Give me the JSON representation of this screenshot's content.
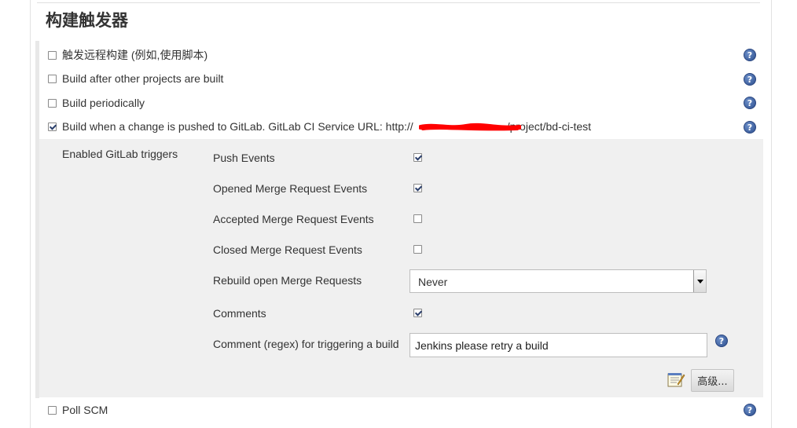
{
  "section": {
    "title": "构建触发器"
  },
  "triggers": [
    {
      "label": "触发远程构建 (例如,使用脚本)",
      "checked": false
    },
    {
      "label": "Build after other projects are built",
      "checked": false
    },
    {
      "label": "Build periodically",
      "checked": false
    },
    {
      "label": "Build when a change is pushed to GitLab. GitLab CI Service URL: http://",
      "url_tail": "/project/bd-ci-test",
      "checked": true
    },
    {
      "label": "Poll SCM",
      "checked": false
    }
  ],
  "gitlab": {
    "group_label": "Enabled GitLab triggers",
    "events": [
      {
        "label": "Push Events",
        "checked": true
      },
      {
        "label": "Opened Merge Request Events",
        "checked": true
      },
      {
        "label": "Accepted Merge Request Events",
        "checked": false
      },
      {
        "label": "Closed Merge Request Events",
        "checked": false
      }
    ],
    "rebuild": {
      "label": "Rebuild open Merge Requests",
      "value": "Never"
    },
    "comments": {
      "label": "Comments",
      "checked": true
    },
    "comment_regex": {
      "label": "Comment (regex) for triggering a build",
      "value": "Jenkins please retry a build"
    },
    "advanced_label": "高级..."
  },
  "icons": {
    "help": "help-icon",
    "notepad": "notepad-icon"
  },
  "colors": {
    "subsection_bg": "#f0f0f0",
    "help_icon": "#2d4f8e",
    "redaction": "#ff0000"
  }
}
